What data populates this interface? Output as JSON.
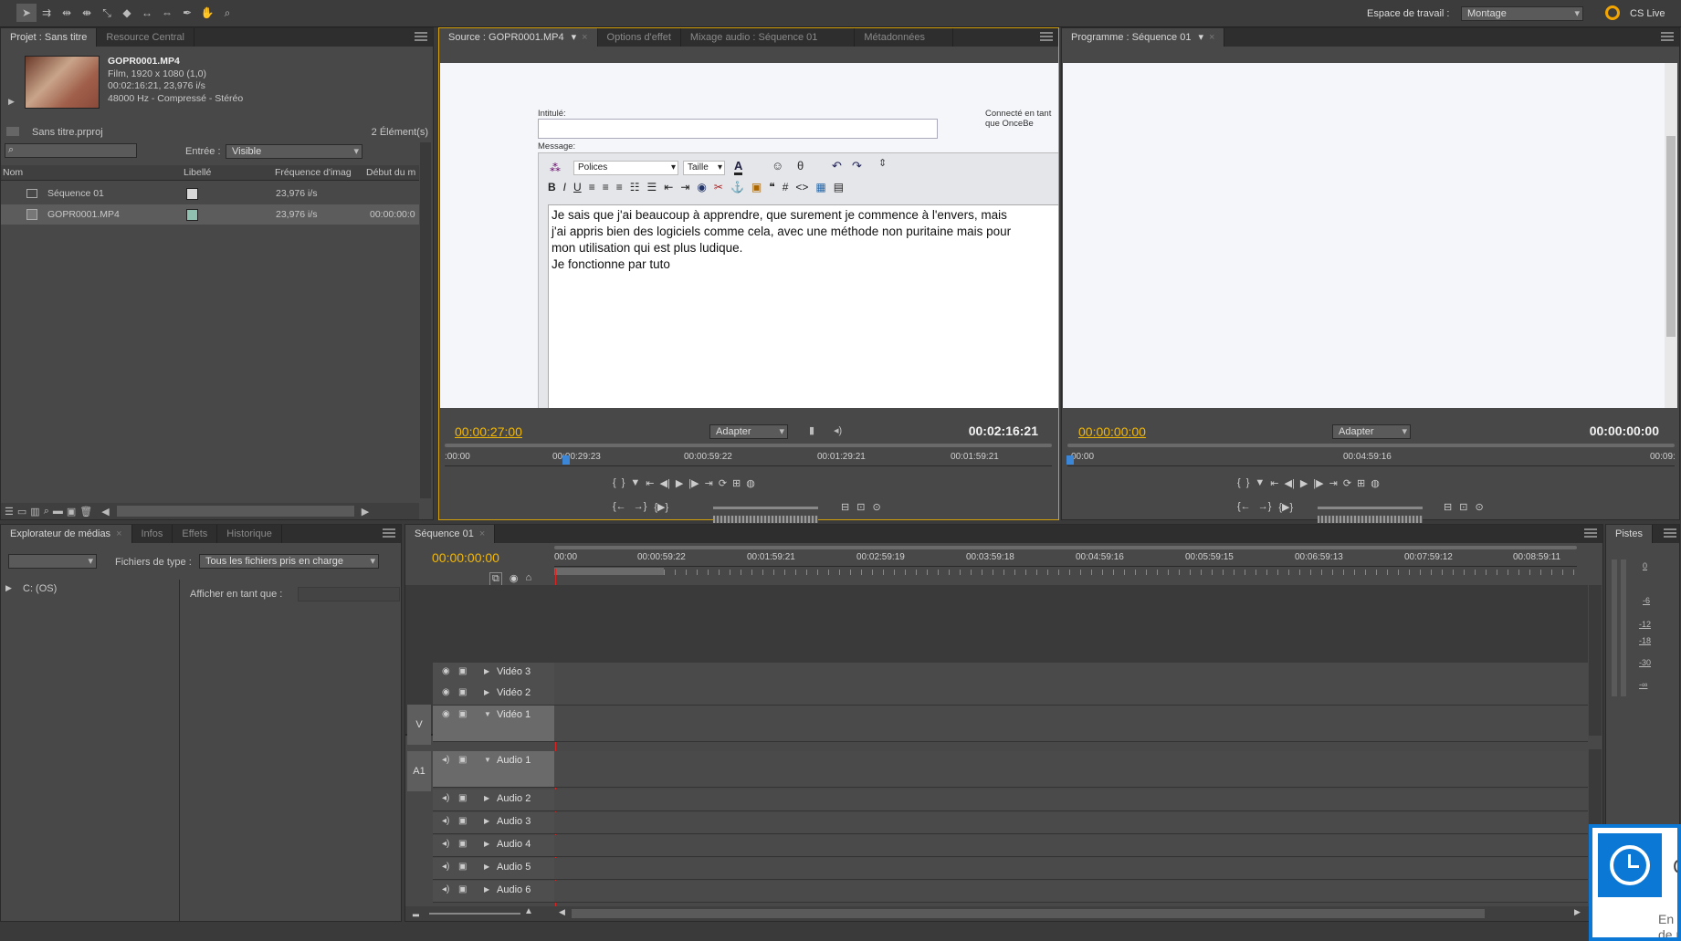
{
  "top_toolbar": {
    "workspace_label": "Espace de travail :",
    "workspace_value": "Montage",
    "cs_live_label": "CS Live"
  },
  "project_panel": {
    "tabs": [
      "Projet : Sans titre",
      "Resource Central"
    ],
    "clip_name": "GOPR0001.MP4",
    "clip_info_1": "Film, 1920 x 1080 (1,0)",
    "clip_info_2": "00:02:16:21, 23,976 i/s",
    "clip_info_3": "48000 Hz - Compressé - Stéréo",
    "project_file": "Sans titre.prproj",
    "element_count": "2 Élément(s)",
    "entree_label": "Entrée :",
    "entree_value": "Visible",
    "columns": [
      "Nom",
      "Libellé",
      "Fréquence d'imag",
      "Début du m"
    ],
    "rows": [
      {
        "name": "Séquence 01",
        "fps": "23,976 i/s",
        "start": "",
        "color": "#d8d8d8"
      },
      {
        "name": "GOPR0001.MP4",
        "fps": "23,976 i/s",
        "start": "00:00:00:0",
        "color": "#8fc0b0"
      }
    ]
  },
  "source_panel": {
    "tabs": [
      "Source : GOPR0001.MP4",
      "Options d'effet",
      "Mixage audio : Séquence 01",
      "Métadonnées"
    ],
    "timecode_in": "00:00:27:00",
    "fit_value": "Adapter",
    "timecode_duration": "00:02:16:21",
    "ruler": [
      ":00:00",
      "00:00:29:23",
      "00:00:59:22",
      "00:01:29:21",
      "00:01:59:21"
    ]
  },
  "web_content": {
    "intitule_label": "Intitulé:",
    "connected_text": "Connecté en tant que OnceBe",
    "message_label": "Message:",
    "polices": "Polices",
    "taille": "Taille",
    "message_lines": [
      "Je sais que j'ai beaucoup à apprendre, que surement je commence à l'envers, mais",
      "j'ai appris bien des logiciels comme cela, avec une méthode non puritaine mais pour",
      "mon utilisation qui est plus ludique.",
      "Je fonctionne par tuto"
    ]
  },
  "program_panel": {
    "tab": "Programme : Séquence 01",
    "timecode_in": "00:00:00:00",
    "fit_value": "Adapter",
    "timecode_duration": "00:00:00:00",
    "ruler": [
      "00:00",
      "00:04:59:16",
      "00:09:"
    ]
  },
  "media_panel": {
    "tabs": [
      "Explorateur de médias",
      "Infos",
      "Effets",
      "Historique"
    ],
    "file_type_label": "Fichiers de type :",
    "file_type_value": "Tous les fichiers pris en charge",
    "drive": "C: (OS)",
    "view_as_label": "Afficher en tant que :"
  },
  "timeline": {
    "tab": "Séquence 01",
    "timecode": "00:00:00:00",
    "ruler": [
      "00:00",
      "00:00:59:22",
      "00:01:59:21",
      "00:02:59:19",
      "00:03:59:18",
      "00:04:59:16",
      "00:05:59:15",
      "00:06:59:13",
      "00:07:59:12",
      "00:08:59:11"
    ],
    "video_tracks": [
      "Vidéo 3",
      "Vidéo 2",
      "Vidéo 1"
    ],
    "audio_tracks": [
      "Audio 1",
      "Audio 2",
      "Audio 3",
      "Audio 4",
      "Audio 5",
      "Audio 6"
    ],
    "v_label": "V",
    "a_label": "A1"
  },
  "pistes_panel": {
    "tab": "Pistes",
    "ticks": [
      "0",
      "-6",
      "-12",
      "-18",
      "-30",
      "-∞"
    ]
  },
  "notification": {
    "text_right": "C",
    "text_bottom": "En c de n"
  }
}
